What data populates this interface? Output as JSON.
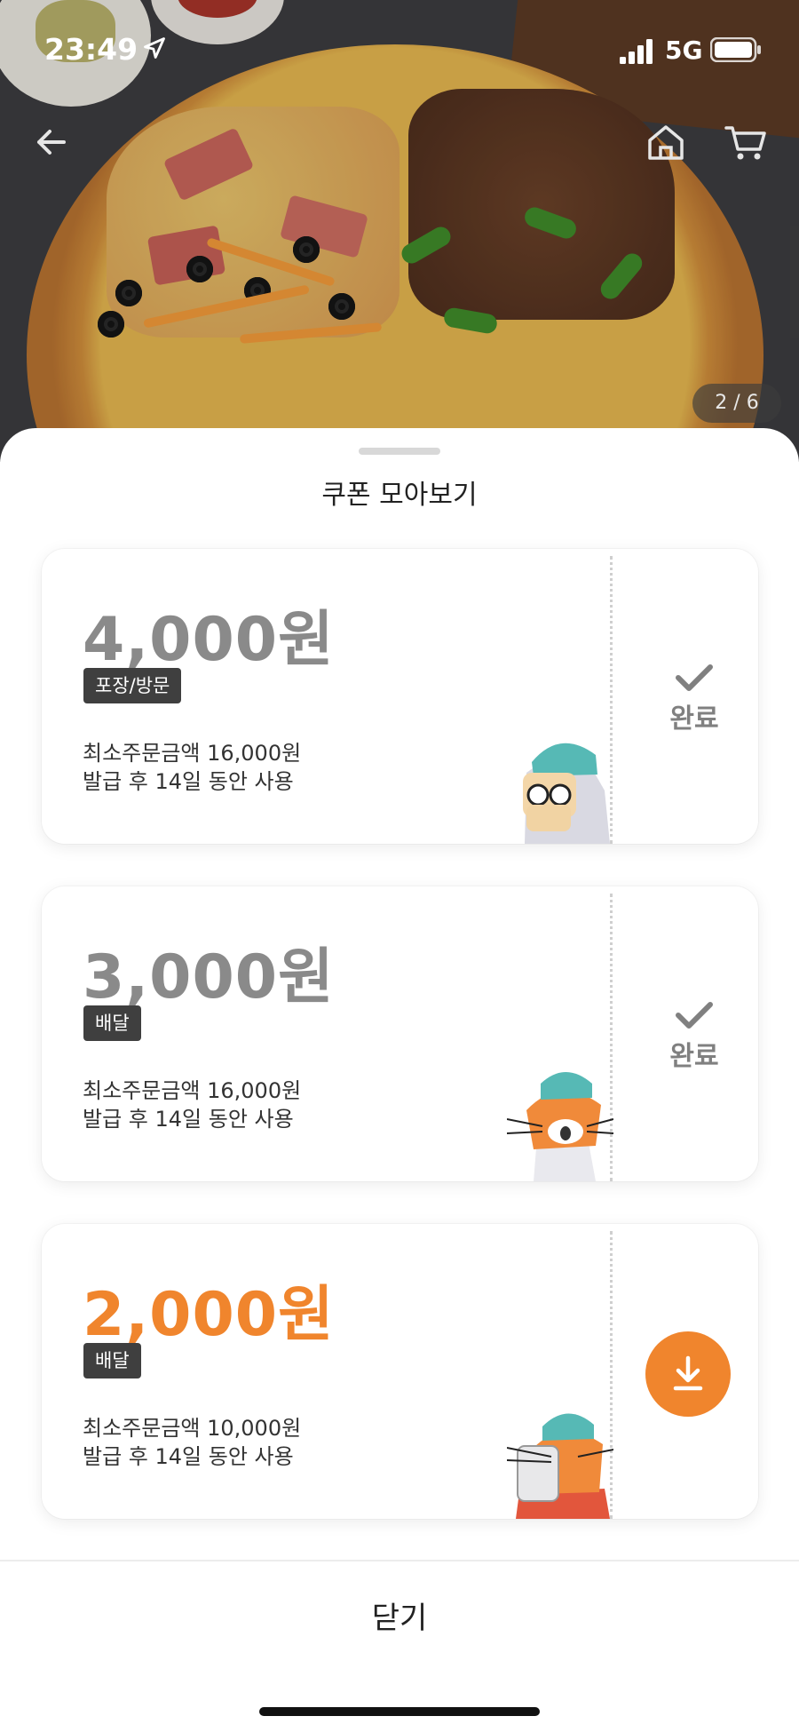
{
  "status_bar": {
    "time": "23:49",
    "network": "5G"
  },
  "header": {
    "back_icon": "arrow-left-icon",
    "home_icon": "home-icon",
    "cart_icon": "cart-icon"
  },
  "gallery": {
    "counter": "2 / 6"
  },
  "sheet": {
    "title": "쿠폰 모아보기",
    "coupons": [
      {
        "amount": "4,000원",
        "tag": "포장/방문",
        "min_order": "최소주문금액 16,000원",
        "validity": "발급 후 14일 동안 사용",
        "state": "완료"
      },
      {
        "amount": "3,000원",
        "tag": "배달",
        "min_order": "최소주문금액 16,000원",
        "validity": "발급 후 14일 동안 사용",
        "state": "완료"
      },
      {
        "amount": "2,000원",
        "tag": "배달",
        "min_order": "최소주문금액 10,000원",
        "validity": "발급 후 14일 동안 사용",
        "state": "download"
      }
    ],
    "close_label": "닫기"
  },
  "colors": {
    "accent": "#f0852d",
    "tag_bg": "#3f3f3f",
    "used_text": "#8a8a8a"
  }
}
